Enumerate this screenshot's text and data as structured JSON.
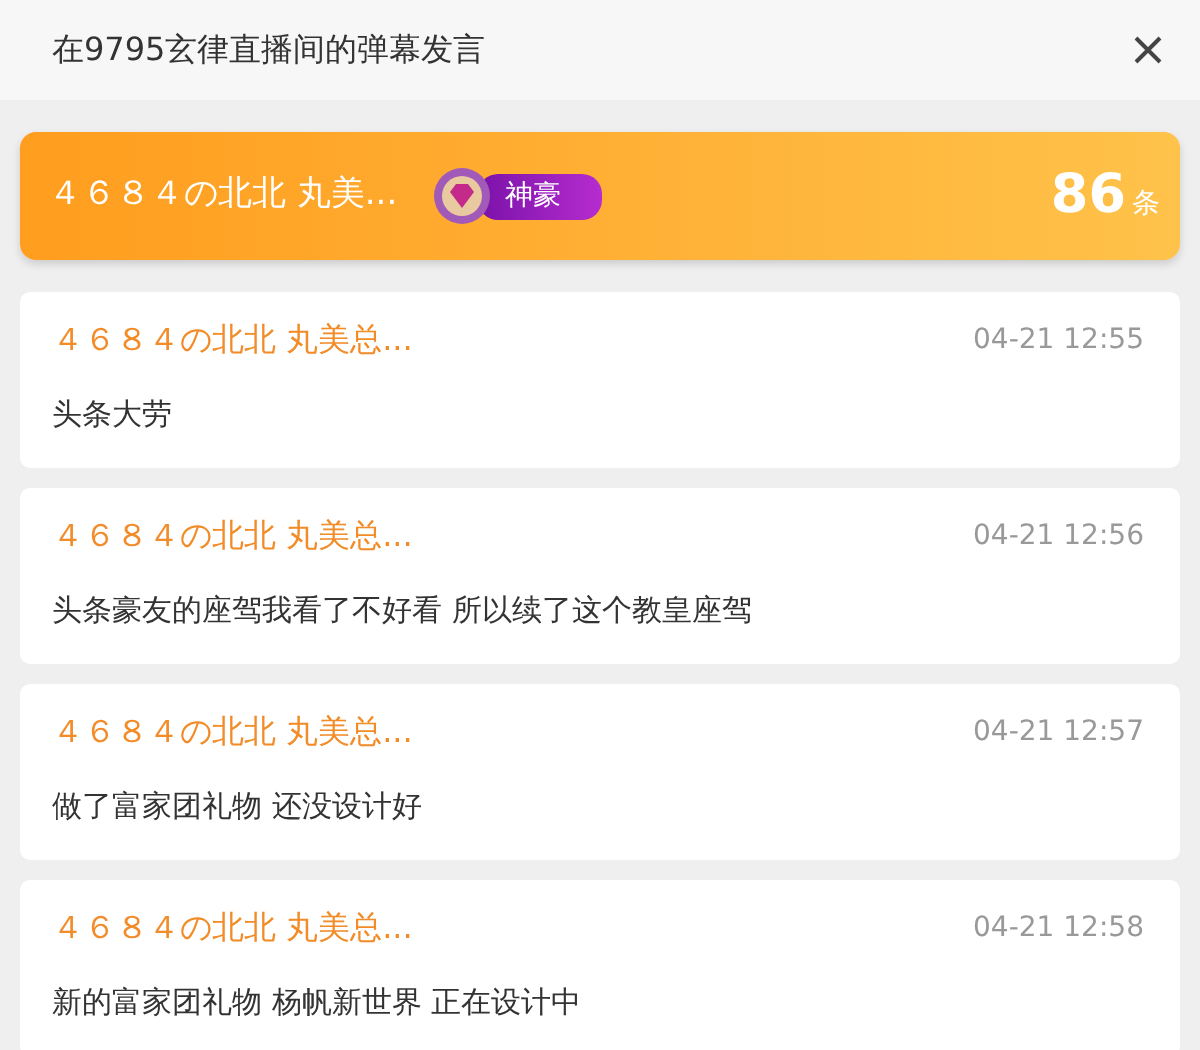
{
  "window": {
    "title": "在9795玄律直播间的弹幕发言"
  },
  "summary": {
    "user": "４６８４の北北 丸美...",
    "badge": "神豪",
    "count": "86",
    "unit": "条"
  },
  "messages": [
    {
      "user": "４６８４の北北 丸美总...",
      "time": "04-21 12:55",
      "text": "头条大劳"
    },
    {
      "user": "４６８４の北北 丸美总...",
      "time": "04-21 12:56",
      "text": "头条豪友的座驾我看了不好看 所以续了这个教皇座驾"
    },
    {
      "user": "４６８４の北北 丸美总...",
      "time": "04-21 12:57",
      "text": "做了富家团礼物 还没设计好"
    },
    {
      "user": "４６８４の北北 丸美总...",
      "time": "04-21 12:58",
      "text": "新的富家团礼物 杨帆新世界 正在设计中"
    }
  ]
}
